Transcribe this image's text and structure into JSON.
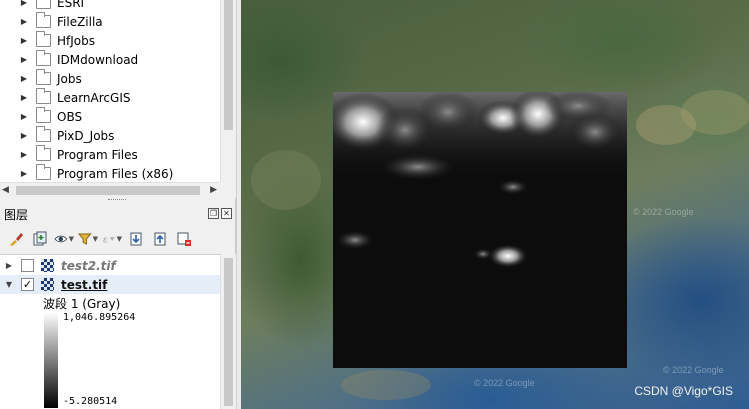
{
  "browser": {
    "items": [
      {
        "label": "ESRI"
      },
      {
        "label": "FileZilla"
      },
      {
        "label": "HfJobs"
      },
      {
        "label": "IDMdownload"
      },
      {
        "label": "Jobs"
      },
      {
        "label": "LearnArcGIS"
      },
      {
        "label": "OBS"
      },
      {
        "label": "PixD_Jobs"
      },
      {
        "label": "Program Files"
      },
      {
        "label": "Program Files (x86)"
      }
    ]
  },
  "layers_panel": {
    "title": "图层",
    "layers": [
      {
        "name": "test2.tif",
        "checked": false,
        "expanded": false
      },
      {
        "name": "test.tif",
        "checked": true,
        "expanded": true
      }
    ],
    "legend": {
      "band_label": "波段 1 (Gray)",
      "max": "1,046.895264",
      "min": "-5.280514"
    }
  },
  "map": {
    "watermark": "CSDN @Vigo*GIS",
    "google_credit_1": "© 2022 Google",
    "google_credit_2": "© 2022 Google",
    "google_credit_3": "© 2022 Google"
  },
  "colors": {
    "raster_background": "#0c0c0c",
    "ramp_top": "#ffffff",
    "ramp_bottom": "#000000"
  }
}
